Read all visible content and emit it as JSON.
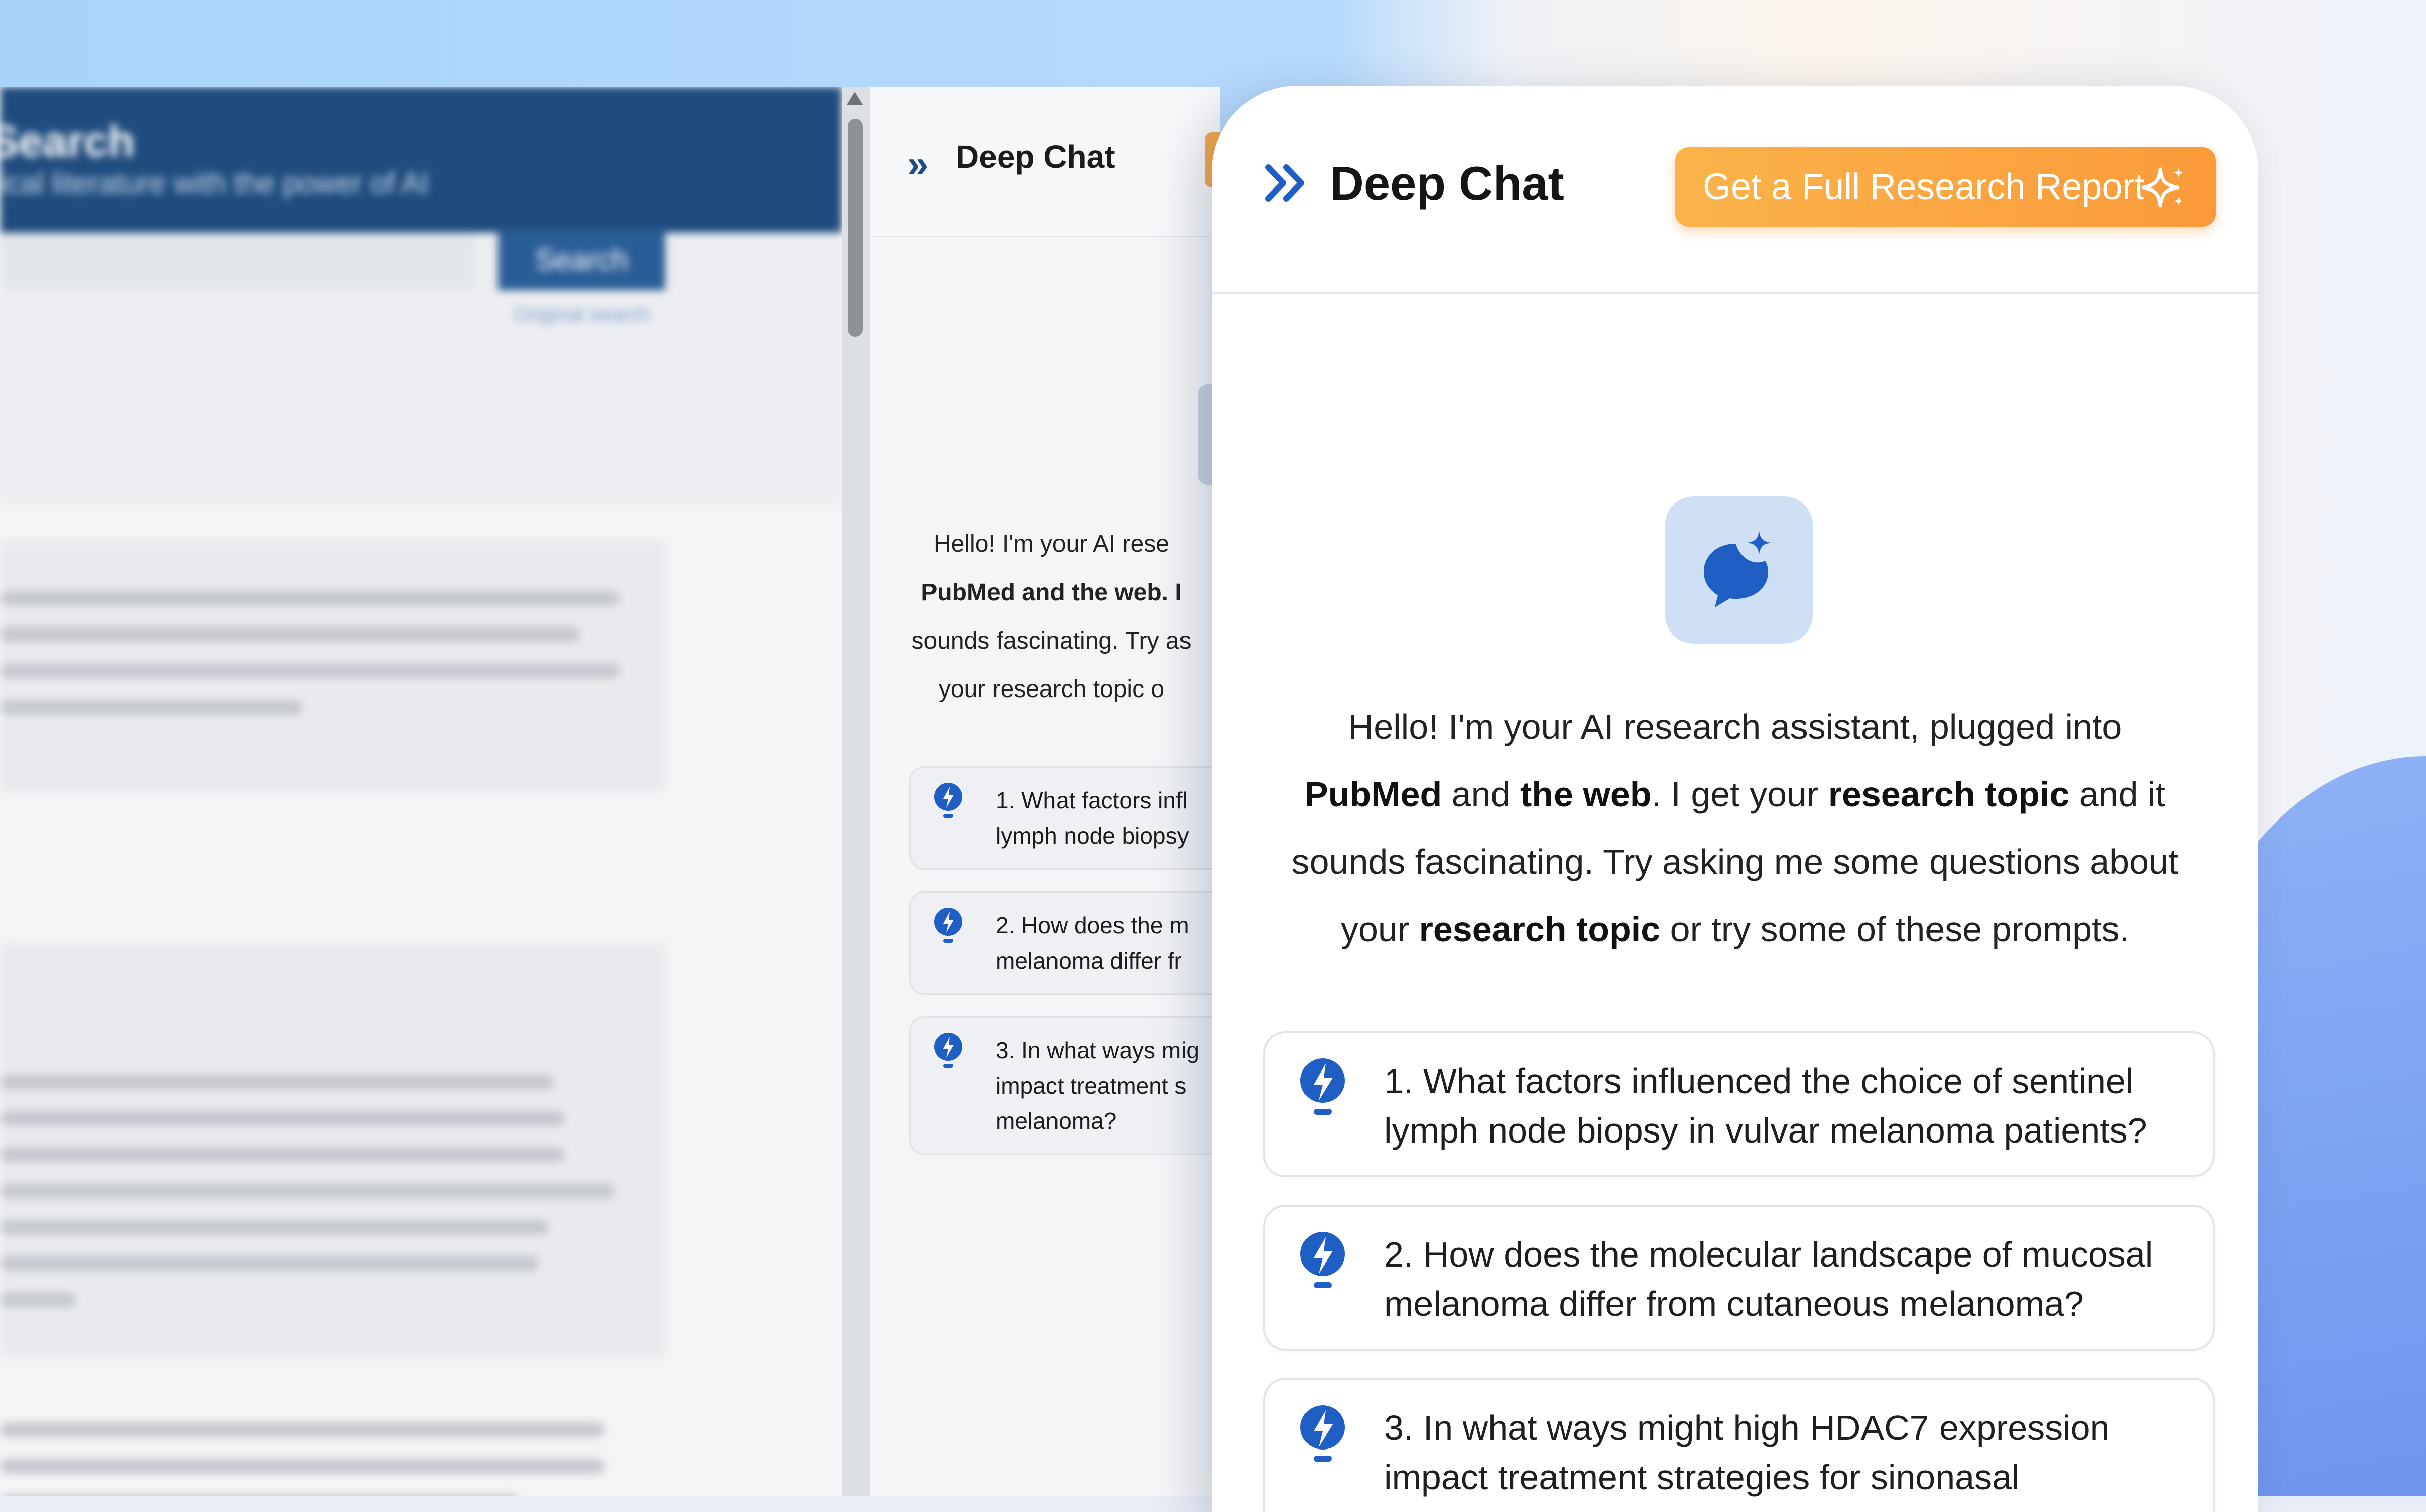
{
  "background_page": {
    "title": "Search",
    "subtitle": "ical literature with the power of AI",
    "search_button": "Search",
    "advanced_link": "Original search"
  },
  "mid_panel": {
    "title": "Deep Chat",
    "greeting_lines": [
      "Hello! I'm your AI rese",
      "PubMed and the web. I",
      "sounds fascinating. Try as",
      "your research topic o"
    ],
    "prompts": [
      [
        "1. What factors infl",
        "lymph node biopsy"
      ],
      [
        "2. How does the m",
        "melanoma differ fr"
      ],
      [
        "3. In what ways mig",
        "impact treatment s",
        "melanoma?"
      ]
    ]
  },
  "chat": {
    "title": "Deep Chat",
    "report_button": "Get a Full Research Report",
    "greeting": {
      "l1": "Hello! I'm your AI research assistant, plugged into",
      "l2a": "PubMed",
      "l2b": " and ",
      "l2c": "the web",
      "l2d": ". I get your ",
      "l2e": "research topic",
      "l2f": " and it",
      "l3": "sounds fascinating. Try asking me some questions about",
      "l4a": "your ",
      "l4b": "research topic",
      "l4c": " or try some of these prompts."
    },
    "prompts": [
      {
        "line1": "1. What factors influenced the choice of sentinel",
        "line2": "lymph node biopsy in vulvar melanoma patients?"
      },
      {
        "line1": "2. How does the molecular landscape of mucosal",
        "line2": "melanoma differ from cutaneous melanoma?"
      },
      {
        "line1": "3. In what ways might high HDAC7 expression",
        "line2": "impact treatment strategies for sinonasal"
      }
    ]
  },
  "colors": {
    "brand_blue": "#1f5fc4",
    "header_navy": "#1f4c7e",
    "report_orange": "#fba542"
  }
}
